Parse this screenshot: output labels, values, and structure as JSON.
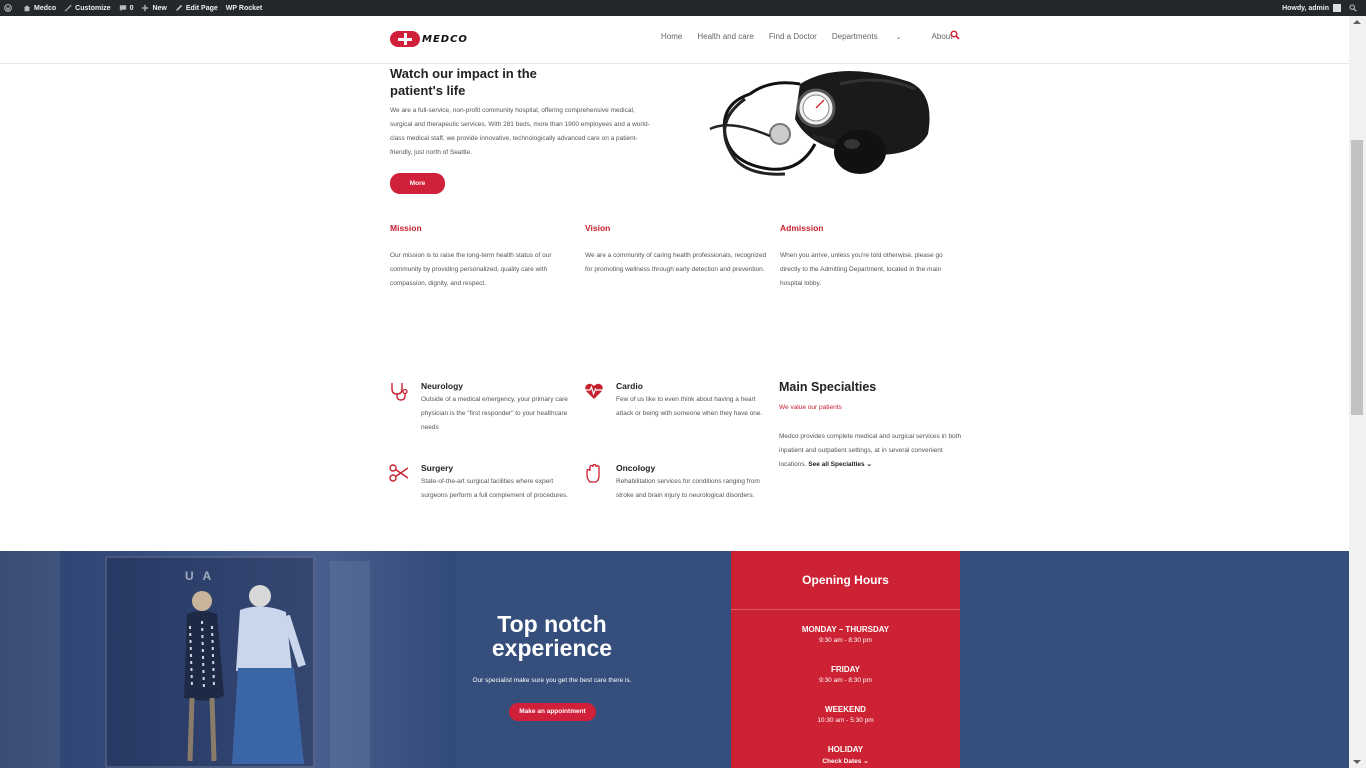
{
  "adminbar": {
    "site": "Medco",
    "customize": "Customize",
    "comments": "0",
    "new": "New",
    "edit": "Edit Page",
    "rocket": "WP Rocket",
    "howdy": "Howdy, admin"
  },
  "header": {
    "logo_text": "MEDCO",
    "nav": [
      {
        "label": "Home"
      },
      {
        "label": "Health and care"
      },
      {
        "label": "Find a Doctor"
      },
      {
        "label": "Departments"
      },
      {
        "label": "About"
      }
    ]
  },
  "intro": {
    "title": "Watch our impact in the patient's life",
    "text": "We are a full-service, non-profit community hospital, offering comprehensive medical, surgical and therapeutic services. With 281 beds, more than 1900 employees and a world-class medical staff, we provide innovative, technologically advanced care on a patient-friendly, just north of Seattle.",
    "button": "More"
  },
  "mva": [
    {
      "title": "Mission",
      "text": "Our mission is to raise the long-term health status of our community by providing personalized, quality care with compassion, dignity, and respect."
    },
    {
      "title": "Vision",
      "text": "We are a community of caring health professionals, recognized for promoting wellness through early detection and prevention."
    },
    {
      "title": "Admission",
      "text": "When you arrive, unless you're told otherwise, please go directly to the Admitting Department, located in the main hospital lobby."
    }
  ],
  "specialties": [
    {
      "title": "Neurology",
      "icon": "stethoscope-icon",
      "text": "Outside of a medical emergency, your primary care physician is the \"first responder\" to your healthcare needs"
    },
    {
      "title": "Cardio",
      "icon": "heart-pulse-icon",
      "text": "Few of us like to even think about having a heart attack or being with someone when they have one."
    },
    {
      "title": "Surgery",
      "icon": "scissors-icon",
      "text": "State-of-the-art surgical facilities where expert surgeons perform a full complement of procedures."
    },
    {
      "title": "Oncology",
      "icon": "hand-icon",
      "text": "Rehabilitation services for conditions ranging from stroke and brain injury to neurological disorders."
    }
  ],
  "main_specialties": {
    "title": "Main Specialties",
    "subtitle": "We value our patients",
    "text": "Medco provides complete medical and surgical services in both inpatient and outpatient settings, at in several convenient locations.",
    "link": "See all Specialties"
  },
  "band": {
    "photo_sign": "U  A",
    "title": "Top notch experience",
    "text": "Our specialist make sure you get the best care there is.",
    "button": "Make an appointment"
  },
  "hours": {
    "title": "Opening Hours",
    "rows": [
      {
        "day": "MONDAY – THURSDAY",
        "time": "9:30 am - 8:30 pm"
      },
      {
        "day": "FRIDAY",
        "time": "9:30 am - 8:30 pm"
      },
      {
        "day": "WEEKEND",
        "time": "10:30 am - 5:30 pm"
      },
      {
        "day": "HOLIDAY",
        "time": "Check Dates"
      }
    ]
  },
  "colors": {
    "accent": "#d0203a",
    "band": "#354e7c",
    "hours": "#cc2233"
  }
}
